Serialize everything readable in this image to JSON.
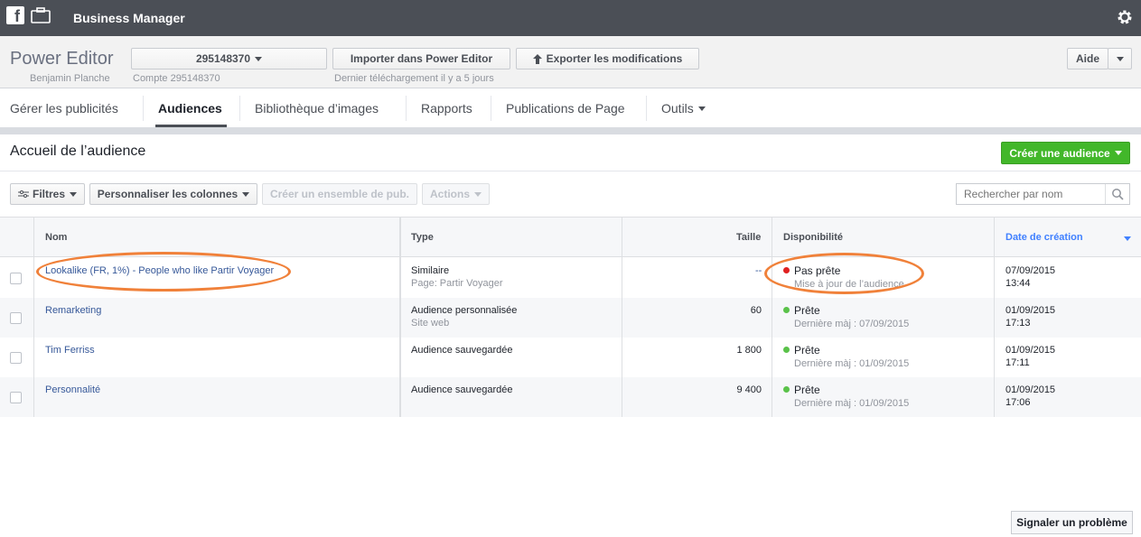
{
  "topbar": {
    "title": "Business Manager",
    "icons": [
      "facebook-icon",
      "briefcase-icon",
      "gear-icon"
    ]
  },
  "power_editor": {
    "title": "Power Editor",
    "user": "Benjamin Planche",
    "account_select": "295148370",
    "account_note": "Compte 295148370",
    "import_label": "Importer dans Power Editor",
    "export_label": "Exporter les modifications",
    "download_note": "Dernier téléchargement il y a 5 jours",
    "help_label": "Aide"
  },
  "nav": {
    "items": [
      {
        "label": "Gérer les publicités"
      },
      {
        "label": "Audiences"
      },
      {
        "label": "Bibliothèque d’images"
      },
      {
        "label": "Rapports"
      },
      {
        "label": "Publications de Page"
      },
      {
        "label": "Outils"
      }
    ],
    "active": "Audiences"
  },
  "page": {
    "heading": "Accueil de l’audience",
    "create_label": "Créer une audience"
  },
  "toolbar": {
    "filters_label": "Filtres",
    "columns_label": "Personnaliser les colonnes",
    "create_adset_label": "Créer un ensemble de pub.",
    "actions_label": "Actions",
    "search_placeholder": "Rechercher par nom"
  },
  "table": {
    "headers": {
      "name": "Nom",
      "type": "Type",
      "size": "Taille",
      "availability": "Disponibilité",
      "created": "Date de création"
    },
    "rows": [
      {
        "name": "Lookalike (FR, 1%) - People who like Partir Voyager",
        "type": "Similaire",
        "type_sub": "Page: Partir Voyager",
        "size": "--",
        "status": "Pas prête",
        "status_sub": "Mise à jour de l’audience",
        "status_color": "#e02020",
        "date": "07/09/2015",
        "time": "13:44"
      },
      {
        "name": "Remarketing",
        "type": "Audience personnalisée",
        "type_sub": "Site web",
        "size": "60",
        "status": "Prête",
        "status_sub": "Dernière màj : 07/09/2015",
        "status_color": "#5ac24a",
        "date": "01/09/2015",
        "time": "17:13"
      },
      {
        "name": "Tim Ferriss",
        "type": "Audience sauvegardée",
        "type_sub": "",
        "size": "1 800",
        "status": "Prête",
        "status_sub": "Dernière màj : 01/09/2015",
        "status_color": "#5ac24a",
        "date": "01/09/2015",
        "time": "17:11"
      },
      {
        "name": "Personnalité",
        "type": "Audience sauvegardée",
        "type_sub": "",
        "size": "9 400",
        "status": "Prête",
        "status_sub": "Dernière màj : 01/09/2015",
        "status_color": "#5ac24a",
        "date": "01/09/2015",
        "time": "17:06"
      }
    ]
  },
  "footer": {
    "report_label": "Signaler un problème"
  },
  "colors": {
    "accent": "#365899",
    "green": "#42b72a",
    "annotation": "#f0813a"
  }
}
